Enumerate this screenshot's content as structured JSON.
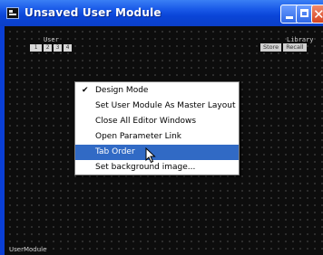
{
  "window": {
    "title": "Unsaved User Module",
    "close_glyph": "✕"
  },
  "editor": {
    "user_label": "User",
    "user_buttons": [
      "1",
      "2",
      "3",
      "4"
    ],
    "library_label": "Library",
    "library_buttons": [
      "Store",
      "Recall"
    ],
    "footer_label": "UserModule"
  },
  "context_menu": {
    "items": [
      {
        "label": "Design Mode",
        "checked": true,
        "check_glyph": "✔"
      },
      {
        "label": "Set User Module As Master Layout"
      },
      {
        "label": "Close All Editor Windows"
      },
      {
        "label": "Open Parameter Link"
      },
      {
        "label": "Tab Order",
        "highlighted": true
      },
      {
        "label": "Set background image..."
      }
    ]
  },
  "colors": {
    "titlebar": "#0a45d8",
    "canvas": "#0d0d0d",
    "menu_highlight": "#316ac5"
  }
}
